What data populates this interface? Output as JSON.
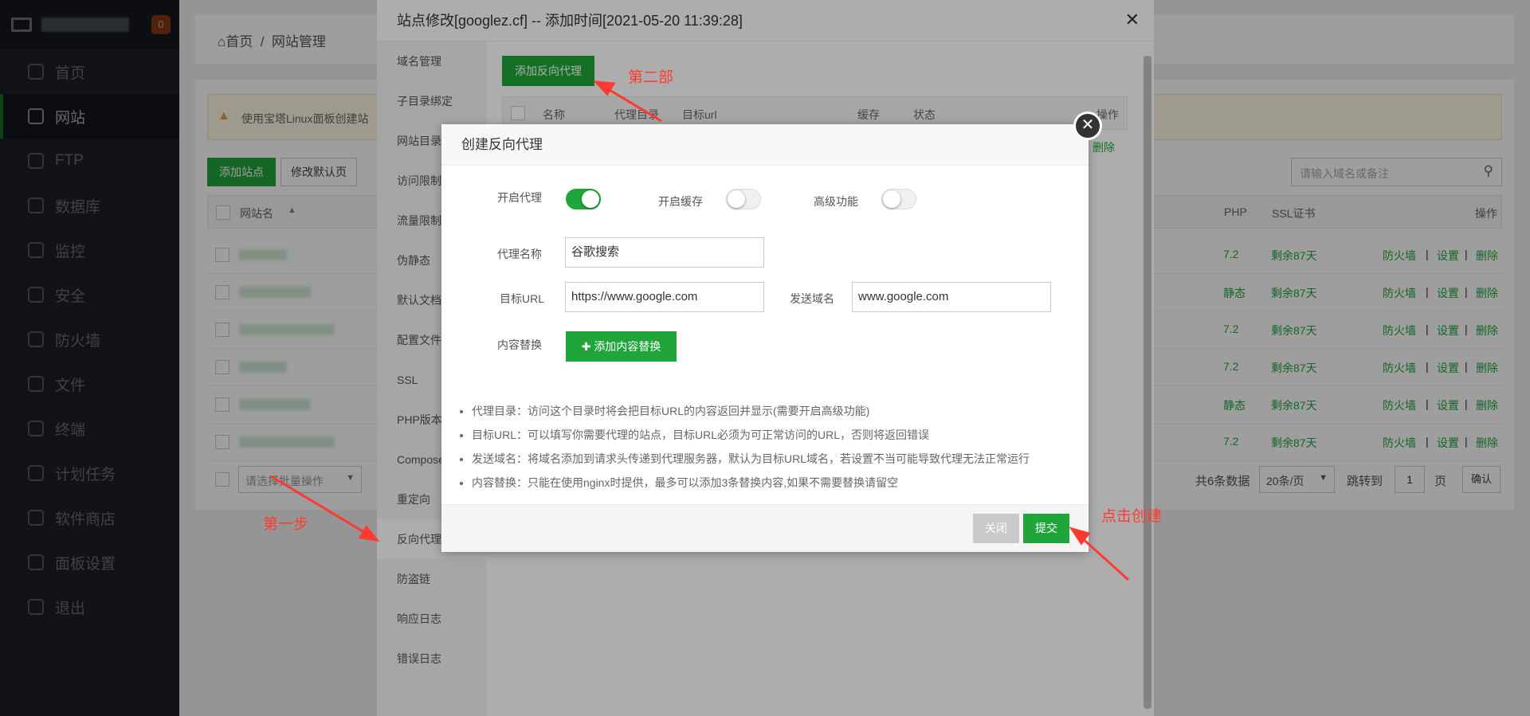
{
  "sidebar": {
    "badge": "0",
    "items": [
      {
        "label": "首页",
        "icon": "home-icon"
      },
      {
        "label": "网站",
        "icon": "globe-icon"
      },
      {
        "label": "FTP",
        "icon": "ftp-icon"
      },
      {
        "label": "数据库",
        "icon": "database-icon"
      },
      {
        "label": "监控",
        "icon": "monitor-icon"
      },
      {
        "label": "安全",
        "icon": "shield-icon"
      },
      {
        "label": "防火墙",
        "icon": "firewall-icon"
      },
      {
        "label": "文件",
        "icon": "folder-icon"
      },
      {
        "label": "终端",
        "icon": "terminal-icon"
      },
      {
        "label": "计划任务",
        "icon": "calendar-icon"
      },
      {
        "label": "软件商店",
        "icon": "grid-icon"
      },
      {
        "label": "面板设置",
        "icon": "gear-icon"
      },
      {
        "label": "退出",
        "icon": "logout-icon"
      }
    ]
  },
  "breadcrumb": {
    "home": "首页",
    "sep": "/",
    "current": "网站管理"
  },
  "main": {
    "notice": "使用宝塔Linux面板创建站",
    "add_site": "添加站点",
    "modify_default": "修改默认页",
    "search_placeholder": "请输入域名或备注",
    "headers": {
      "name": "网站名",
      "php": "PHP",
      "ssl": "SSL证书",
      "ops": "操作"
    },
    "rows": [
      {
        "php": "7.2",
        "ssl": "剩余87天"
      },
      {
        "php": "静态",
        "ssl": "剩余87天"
      },
      {
        "php": "7.2",
        "ssl": "剩余87天"
      },
      {
        "php": "7.2",
        "ssl": "剩余87天"
      },
      {
        "php": "静态",
        "ssl": "剩余87天"
      },
      {
        "php": "7.2",
        "ssl": "剩余87天"
      }
    ],
    "op_firewall": "防火墙",
    "op_settings": "设置",
    "op_delete": "删除",
    "op_sep": "|",
    "batch_placeholder": "请选择批量操作",
    "total": "共6条数据",
    "per_page": "20条/页",
    "jump_to": "跳转到",
    "page_num": "1",
    "page_unit": "页",
    "confirm": "确认"
  },
  "site_dialog": {
    "title": "站点修改[googlez.cf] -- 添加时间[2021-05-20 11:39:28]",
    "menu": [
      "域名管理",
      "子目录绑定",
      "网站目录",
      "访问限制",
      "流量限制",
      "伪静态",
      "默认文档",
      "配置文件",
      "SSL",
      "PHP版本",
      "Composer",
      "重定向",
      "反向代理",
      "防盗链",
      "响应日志",
      "错误日志"
    ],
    "add_proxy": "添加反向代理",
    "table_headers": [
      "名称",
      "代理目录",
      "目标url",
      "缓存",
      "状态",
      "操作"
    ],
    "row_delete": "删除"
  },
  "proxy_dialog": {
    "title": "创建反向代理",
    "enable_proxy": "开启代理",
    "enable_cache": "开启缓存",
    "advanced": "高级功能",
    "enable_proxy_on": true,
    "enable_cache_on": false,
    "advanced_on": false,
    "proxy_name_label": "代理名称",
    "proxy_name_value": "谷歌搜索",
    "target_url_label": "目标URL",
    "target_url_value": "https://www.google.com",
    "send_domain_label": "发送域名",
    "send_domain_value": "www.google.com",
    "content_replace_label": "内容替换",
    "add_replace": "添加内容替换",
    "tips": [
      "代理目录：访问这个目录时将会把目标URL的内容返回并显示(需要开启高级功能)",
      "目标URL：可以填写你需要代理的站点，目标URL必须为可正常访问的URL，否则将返回错误",
      "发送域名：将域名添加到请求头传递到代理服务器，默认为目标URL域名，若设置不当可能导致代理无法正常运行",
      "内容替换：只能在使用nginx时提供，最多可以添加3条替换内容,如果不需要替换请留空"
    ],
    "close": "关闭",
    "submit": "提交"
  },
  "annotations": {
    "step1": "第一步",
    "step2": "第二部",
    "click_create": "点击创建"
  },
  "colors": {
    "accent": "#20a53a",
    "annotation": "#ff3b30",
    "sidebar_bg": "#2b3038"
  }
}
